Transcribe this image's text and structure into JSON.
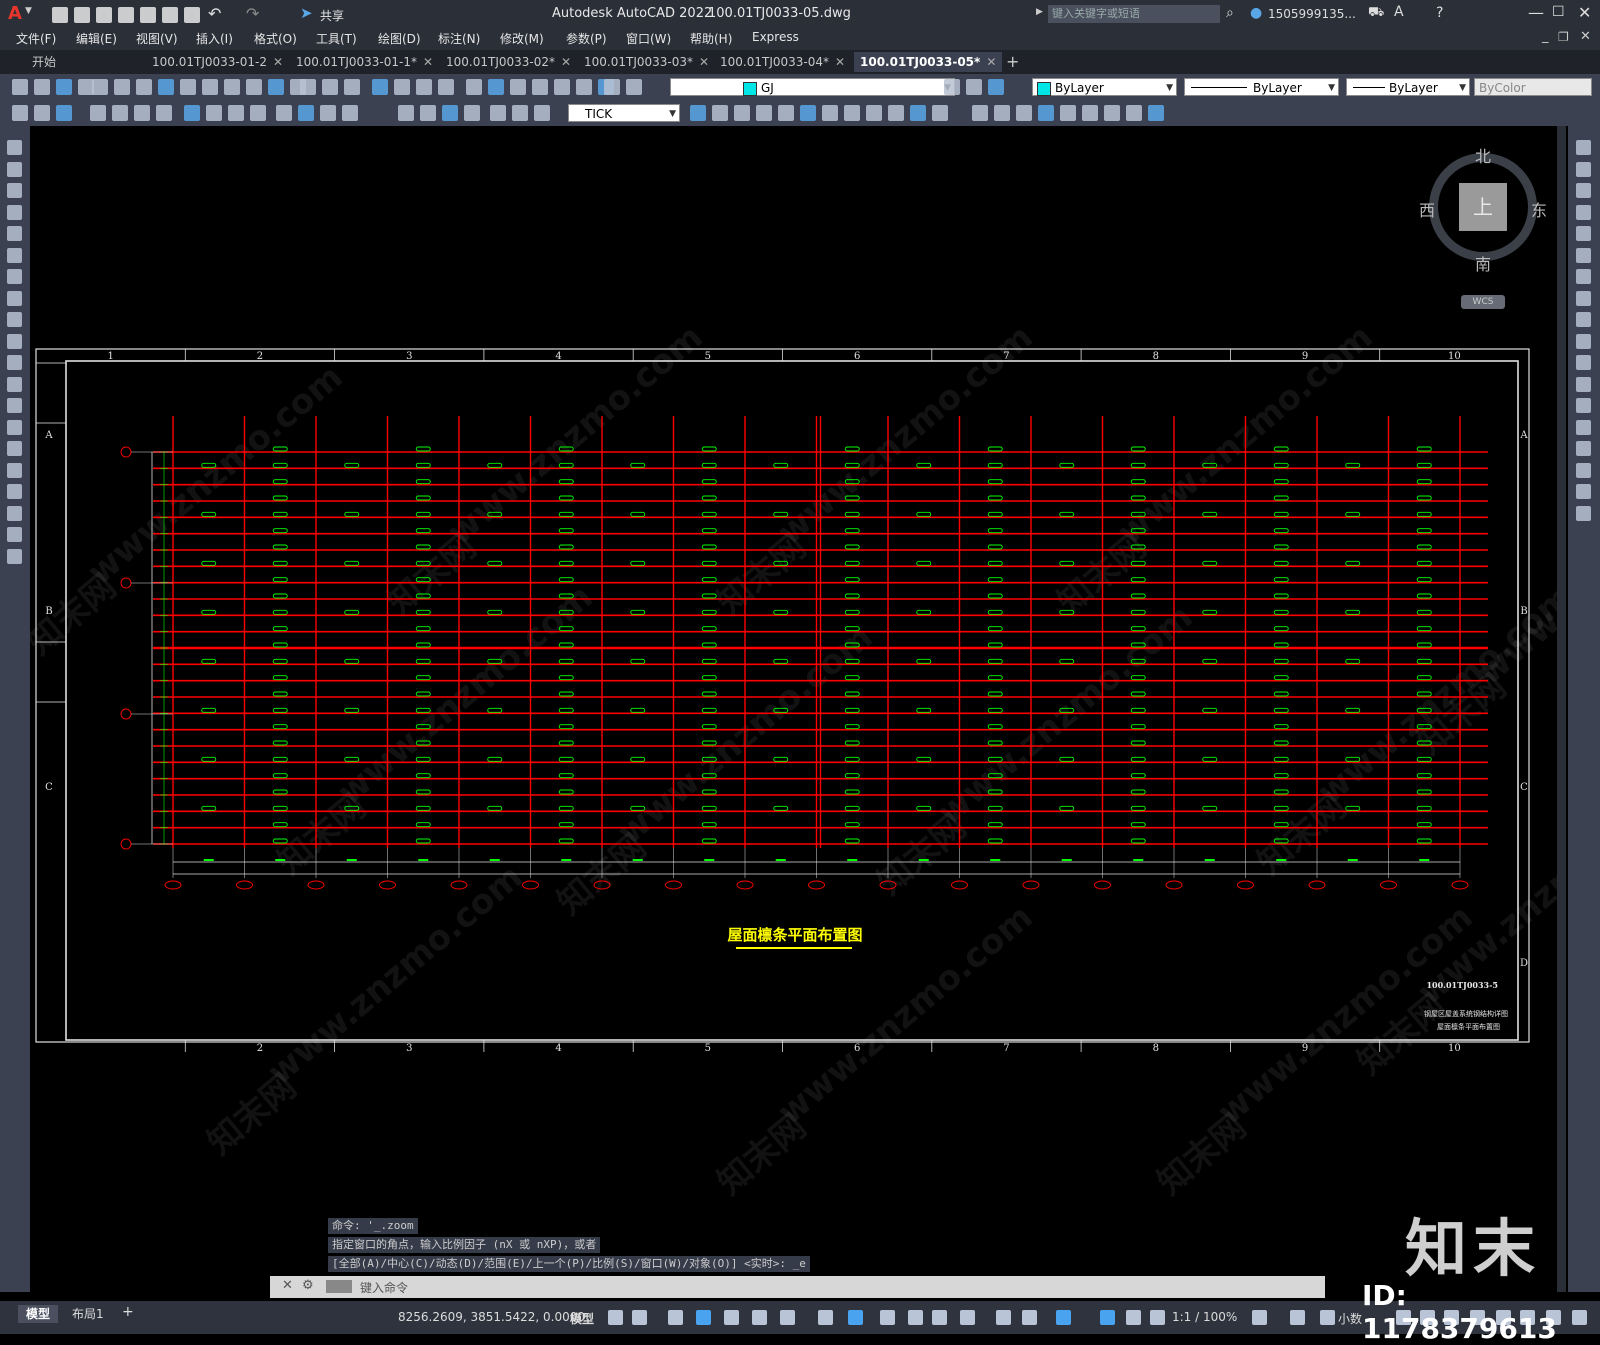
{
  "app": {
    "title": "Autodesk AutoCAD 2022",
    "filename": "100.01TJ0033-05.dwg",
    "share_label": "共享",
    "search_placeholder": "键入关键字或短语",
    "user": "1505999135...",
    "logo": "A"
  },
  "menu": [
    "文件(F)",
    "编辑(E)",
    "视图(V)",
    "插入(I)",
    "格式(O)",
    "工具(T)",
    "绘图(D)",
    "标注(N)",
    "修改(M)",
    "参数(P)",
    "窗口(W)",
    "帮助(H)",
    "Express"
  ],
  "tabs": [
    {
      "label": "开始",
      "active": false,
      "close": false
    },
    {
      "label": "100.01TJ0033-01-2",
      "active": false,
      "close": true
    },
    {
      "label": "100.01TJ0033-01-1*",
      "active": false,
      "close": true
    },
    {
      "label": "100.01TJ0033-02*",
      "active": false,
      "close": true
    },
    {
      "label": "100.01TJ0033-03*",
      "active": false,
      "close": true
    },
    {
      "label": "100.01TJ0033-04*",
      "active": false,
      "close": true
    },
    {
      "label": "100.01TJ0033-05*",
      "active": true,
      "close": true
    }
  ],
  "toolbar": {
    "layer": "GJ",
    "color": "ByLayer",
    "linetype": "ByLayer",
    "lineweight": "ByLayer",
    "plotstyle": "ByColor",
    "dimstyle": "TICK",
    "layer_color": "#00e5e5"
  },
  "viewcube": {
    "north": "北",
    "south": "南",
    "east": "东",
    "west": "西",
    "top": "上",
    "wcs": "WCS"
  },
  "drawing": {
    "title": "屋面檩条平面布置图",
    "drawing_no": "100.01TJ0033-5",
    "subtitle_1": "钢屋区屋盖系统钢结构详图",
    "subtitle_2": "屋面檩条平面布置图",
    "border_cols": [
      "1",
      "2",
      "3",
      "4",
      "5",
      "6",
      "7",
      "8",
      "9",
      "10"
    ],
    "border_rows": [
      "A",
      "B",
      "C",
      "D"
    ],
    "bubble_count": 19,
    "purlin_color": "#ff0000",
    "label_color": "#00ff00",
    "title_color": "#ffff00"
  },
  "command": {
    "history": [
      "命令: '_.zoom",
      "指定窗口的角点，输入比例因子 (nX 或 nXP)，或者",
      "[全部(A)/中心(C)/动态(D)/范围(E)/上一个(P)/比例(S)/窗口(W)/对象(O)] <实时>: _e"
    ],
    "placeholder": "键入命令"
  },
  "status": {
    "layout_tabs": [
      "模型",
      "布局1"
    ],
    "coords": "8256.2609, 3851.5422, 0.0000",
    "model": "模型",
    "scale": "1:1 / 100%",
    "units": "小数"
  },
  "watermark": {
    "logo": "知末",
    "id": "ID: 1178379613",
    "url": "www.znzmo.com",
    "brand": "知末网"
  }
}
